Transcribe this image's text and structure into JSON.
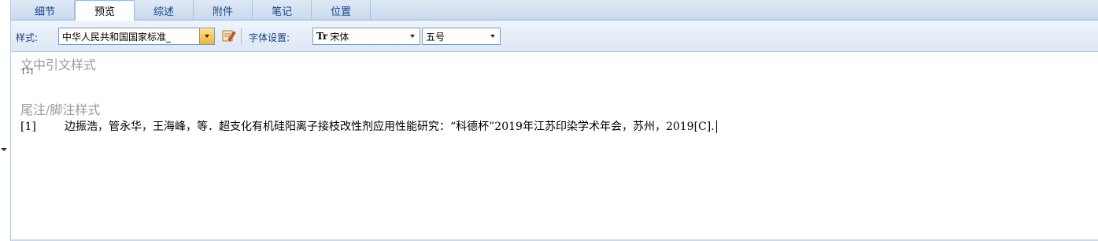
{
  "tabs": [
    {
      "label": "细节",
      "active": false
    },
    {
      "label": "预览",
      "active": true
    },
    {
      "label": "综述",
      "active": false
    },
    {
      "label": "附件",
      "active": false
    },
    {
      "label": "笔记",
      "active": false
    },
    {
      "label": "位置",
      "active": false
    }
  ],
  "toolbar": {
    "style_label": "样式:",
    "style_value": "中华人民共和国国家标准_",
    "font_settings_label": "字体设置:",
    "font_icon_text": "Tr",
    "font_value": "宋体",
    "size_value": "五号",
    "edit_icon": "style-edit-icon"
  },
  "content": {
    "inline_cite_title": "文中引文样式",
    "inline_cite_sample": "[1]",
    "endnote_title": "尾注/脚注样式",
    "reference_number": "[1]",
    "reference_text": "边振浩，管永华，王海峰，等．超支化有机硅阳离子接枝改性剂应用性能研究：“科德杯”2019年江苏印染学术年会，苏州，2019[C]."
  },
  "colors": {
    "tab_text": "#15428b",
    "title_gray": "#9a9a9a",
    "accent_orange": "#f5b32d"
  }
}
